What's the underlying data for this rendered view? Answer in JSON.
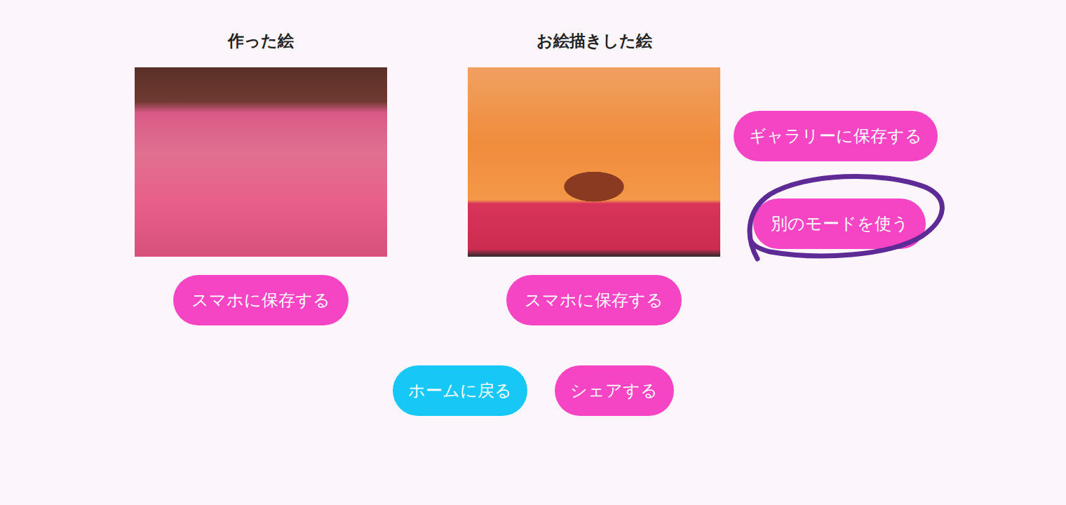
{
  "panels": [
    {
      "title": "作った絵",
      "save_button": "スマホに保存する"
    },
    {
      "title": "お絵描きした絵",
      "save_button": "スマホに保存する"
    }
  ],
  "side_buttons": [
    {
      "label": "ギャラリーに保存する",
      "circled": false
    },
    {
      "label": "別のモードを使う",
      "circled": true
    }
  ],
  "bottom_buttons": [
    {
      "label": "ホームに戻る",
      "kind": "secondary"
    },
    {
      "label": "シェアする",
      "kind": "primary"
    }
  ]
}
